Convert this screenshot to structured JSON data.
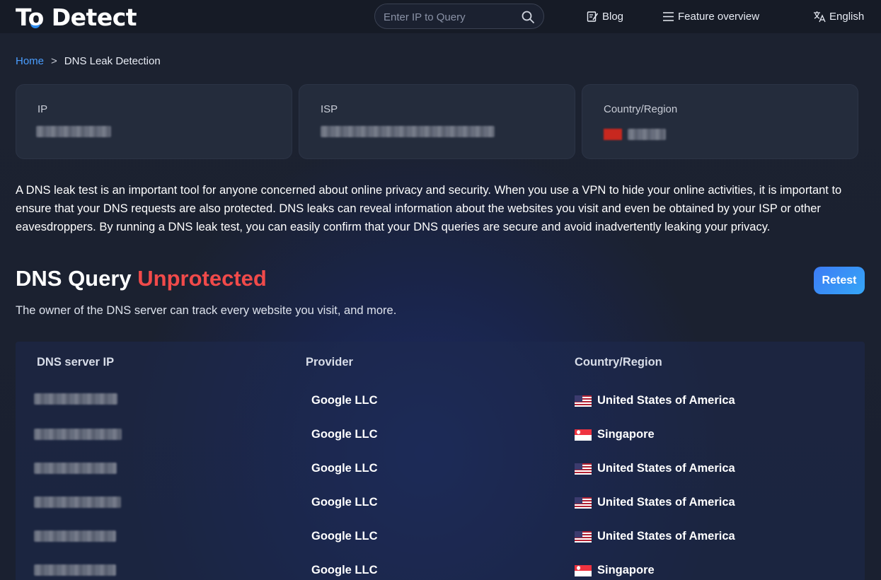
{
  "header": {
    "logo_text": "To Detect",
    "search_placeholder": "Enter IP to Query",
    "nav": {
      "blog": "Blog",
      "features": "Feature overview",
      "language": "English"
    }
  },
  "breadcrumb": {
    "home": "Home",
    "separator": ">",
    "current": "DNS Leak Detection"
  },
  "info_cards": {
    "ip_label": "IP",
    "isp_label": "ISP",
    "country_label": "Country/Region"
  },
  "description": "A DNS leak test is an important tool for anyone concerned about online privacy and security. When you use a VPN to hide your online activities, it is important to ensure that your DNS requests are also protected. DNS leaks can reveal information about the websites you visit and even be obtained by your ISP or other eavesdroppers. By running a DNS leak test, you can easily confirm that your DNS queries are secure and avoid inadvertently leaking your privacy.",
  "result": {
    "title_prefix": "DNS Query",
    "status": "Unprotected",
    "subtitle": "The owner of the DNS server can track every website you visit, and more.",
    "retest_label": "Retest",
    "status_color": "#f04a4a"
  },
  "table": {
    "headers": {
      "ip": "DNS server IP",
      "provider": "Provider",
      "country": "Country/Region"
    },
    "rows": [
      {
        "provider": "Google LLC",
        "country": "United States of America",
        "flag": "us-flag-icon"
      },
      {
        "provider": "Google LLC",
        "country": "Singapore",
        "flag": "sg-flag-icon"
      },
      {
        "provider": "Google LLC",
        "country": "United States of America",
        "flag": "us-flag-icon"
      },
      {
        "provider": "Google LLC",
        "country": "United States of America",
        "flag": "us-flag-icon"
      },
      {
        "provider": "Google LLC",
        "country": "United States of America",
        "flag": "us-flag-icon"
      },
      {
        "provider": "Google LLC",
        "country": "Singapore",
        "flag": "sg-flag-icon"
      }
    ]
  }
}
